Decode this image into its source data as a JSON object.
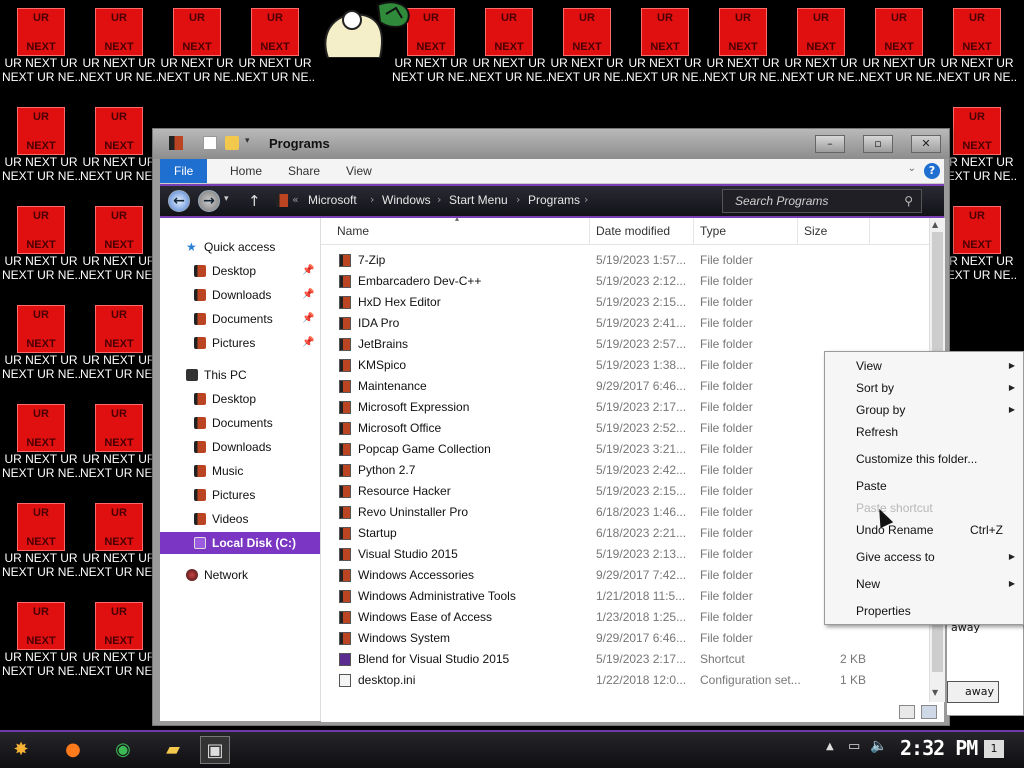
{
  "desktop": {
    "tile_top": "UR",
    "tile_bottom": "NEXT",
    "caption_first_row": "UR NEXT UR NEXT UR NEXT UR NE...",
    "caption_line1": "UR NEXT UR",
    "caption_line2": "NEXT UR NE...",
    "caption_line2_first": "NEXT UR NEXT UR"
  },
  "window": {
    "title": "Programs",
    "ribbon_tabs": [
      "File",
      "Home",
      "Share",
      "View"
    ],
    "breadcrumbs": [
      "Microsoft",
      "Windows",
      "Start Menu",
      "Programs"
    ],
    "search_placeholder": "Search Programs"
  },
  "navpane": {
    "quick_access": "Quick access",
    "quick_items": [
      "Desktop",
      "Downloads",
      "Documents",
      "Pictures"
    ],
    "this_pc": "This PC",
    "pc_items": [
      "Desktop",
      "Documents",
      "Downloads",
      "Music",
      "Pictures",
      "Videos",
      "Local Disk (C:)"
    ],
    "network": "Network"
  },
  "columns": {
    "name": "Name",
    "date": "Date modified",
    "type": "Type",
    "size": "Size"
  },
  "files": [
    {
      "name": "7-Zip",
      "date": "5/19/2023 1:57...",
      "type": "File folder",
      "size": ""
    },
    {
      "name": "Embarcadero Dev-C++",
      "date": "5/19/2023 2:12...",
      "type": "File folder",
      "size": ""
    },
    {
      "name": "HxD Hex Editor",
      "date": "5/19/2023 2:15...",
      "type": "File folder",
      "size": ""
    },
    {
      "name": "IDA Pro",
      "date": "5/19/2023 2:41...",
      "type": "File folder",
      "size": ""
    },
    {
      "name": "JetBrains",
      "date": "5/19/2023 2:57...",
      "type": "File folder",
      "size": ""
    },
    {
      "name": "KMSpico",
      "date": "5/19/2023 1:38...",
      "type": "File folder",
      "size": ""
    },
    {
      "name": "Maintenance",
      "date": "9/29/2017 6:46...",
      "type": "File folder",
      "size": ""
    },
    {
      "name": "Microsoft Expression",
      "date": "5/19/2023 2:17...",
      "type": "File folder",
      "size": ""
    },
    {
      "name": "Microsoft Office",
      "date": "5/19/2023 2:52...",
      "type": "File folder",
      "size": ""
    },
    {
      "name": "Popcap Game Collection",
      "date": "5/19/2023 3:21...",
      "type": "File folder",
      "size": ""
    },
    {
      "name": "Python 2.7",
      "date": "5/19/2023 2:42...",
      "type": "File folder",
      "size": ""
    },
    {
      "name": "Resource Hacker",
      "date": "5/19/2023 2:15...",
      "type": "File folder",
      "size": ""
    },
    {
      "name": "Revo Uninstaller Pro",
      "date": "6/18/2023 1:46...",
      "type": "File folder",
      "size": ""
    },
    {
      "name": "Startup",
      "date": "6/18/2023 2:21...",
      "type": "File folder",
      "size": ""
    },
    {
      "name": "Visual Studio 2015",
      "date": "5/19/2023 2:13...",
      "type": "File folder",
      "size": ""
    },
    {
      "name": "Windows Accessories",
      "date": "9/29/2017 7:42...",
      "type": "File folder",
      "size": ""
    },
    {
      "name": "Windows Administrative Tools",
      "date": "1/21/2018 11:5...",
      "type": "File folder",
      "size": ""
    },
    {
      "name": "Windows Ease of Access",
      "date": "1/23/2018 1:25...",
      "type": "File folder",
      "size": ""
    },
    {
      "name": "Windows System",
      "date": "9/29/2017 6:46...",
      "type": "File folder",
      "size": ""
    },
    {
      "name": "Blend for Visual Studio 2015",
      "date": "5/19/2023 2:17...",
      "type": "Shortcut",
      "size": "2 KB"
    },
    {
      "name": "desktop.ini",
      "date": "1/22/2018 12:0...",
      "type": "Configuration set...",
      "size": "1 KB"
    }
  ],
  "context_menu": {
    "view": "View",
    "sort_by": "Sort by",
    "group_by": "Group by",
    "refresh": "Refresh",
    "customize": "Customize this folder...",
    "paste": "Paste",
    "paste_shortcut": "Paste shortcut",
    "undo_rename": "Undo Rename",
    "undo_shortcut": "Ctrl+Z",
    "give_access": "Give access to",
    "new": "New",
    "properties": "Properties"
  },
  "bg_dialog": {
    "text": "away",
    "button": "away"
  },
  "taskbar": {
    "clock": "2:32 PM",
    "notification_count": "1"
  },
  "colors": {
    "accent": "#7b36c4",
    "ribbon_file": "#1f6fd1",
    "tile_red": "#e01010"
  }
}
